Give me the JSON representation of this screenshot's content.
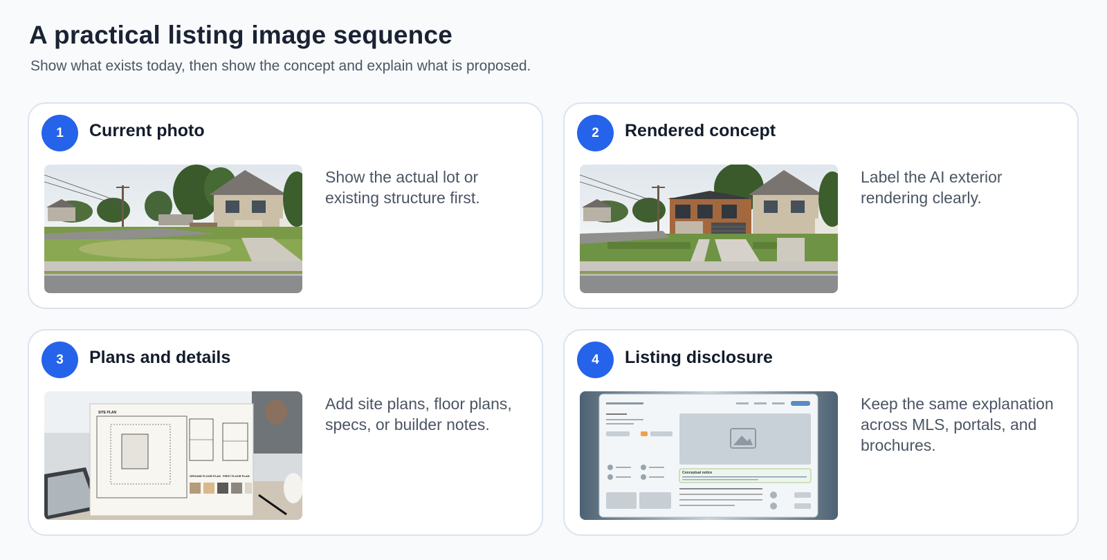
{
  "header": {
    "title": "A practical listing image sequence",
    "subtitle": "Show what exists today, then show the concept and explain what is proposed."
  },
  "cards": [
    {
      "number": "1",
      "title": "Current photo",
      "description": "Show the actual lot or existing structure first.",
      "image": "photo of empty suburban lot next to a house"
    },
    {
      "number": "2",
      "title": "Rendered concept",
      "description": "Label the AI exterior rendering clearly.",
      "image": "rendering of a new modern house on the lot"
    },
    {
      "number": "3",
      "title": "Plans and details",
      "description": "Add site plans, floor plans, specs, or builder notes.",
      "image": "site plan and floor plan sheets on a desk",
      "plan_labels": [
        "SITE PLAN",
        "GROUND FLOOR PLAN",
        "FIRST FLOOR PLAN"
      ]
    },
    {
      "number": "4",
      "title": "Listing disclosure",
      "description": "Keep the same explanation across MLS, portals, and brochures.",
      "image": "listing webpage mockup on a screen",
      "notice_label": "Conceptual notice"
    }
  ],
  "colors": {
    "accent": "#2563eb",
    "background": "#f8fafc",
    "card_border": "#dbe3ee"
  }
}
